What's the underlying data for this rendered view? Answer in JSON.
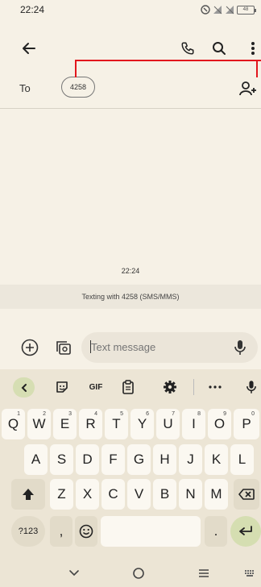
{
  "status_bar": {
    "time": "22:24",
    "battery": "48"
  },
  "app_bar": {
    "back_icon": "arrow-left-icon",
    "phone_icon": "phone-icon",
    "search_icon": "search-icon",
    "more_icon": "more-vert-icon"
  },
  "recipients": {
    "to_label": "To",
    "chip": "4258",
    "add_icon": "add-contact-icon"
  },
  "conversation": {
    "time": "22:24",
    "banner": "Texting with 4258 (SMS/MMS)"
  },
  "compose": {
    "placeholder": "Text message"
  },
  "keyboard": {
    "toolbar": {
      "gif": "GIF"
    },
    "row1": [
      {
        "k": "Q",
        "n": "1"
      },
      {
        "k": "W",
        "n": "2"
      },
      {
        "k": "E",
        "n": "3"
      },
      {
        "k": "R",
        "n": "4"
      },
      {
        "k": "T",
        "n": "5"
      },
      {
        "k": "Y",
        "n": "6"
      },
      {
        "k": "U",
        "n": "7"
      },
      {
        "k": "I",
        "n": "8"
      },
      {
        "k": "O",
        "n": "9"
      },
      {
        "k": "P",
        "n": "0"
      }
    ],
    "row2": [
      "A",
      "S",
      "D",
      "F",
      "G",
      "H",
      "J",
      "K",
      "L"
    ],
    "row3": [
      "Z",
      "X",
      "C",
      "V",
      "B",
      "N",
      "M"
    ],
    "symbols": "?123",
    "comma": ",",
    "period": "."
  },
  "colors": {
    "annotation": "#e2161d",
    "accent": "#d6deb3",
    "background": "#f6f1e6"
  }
}
